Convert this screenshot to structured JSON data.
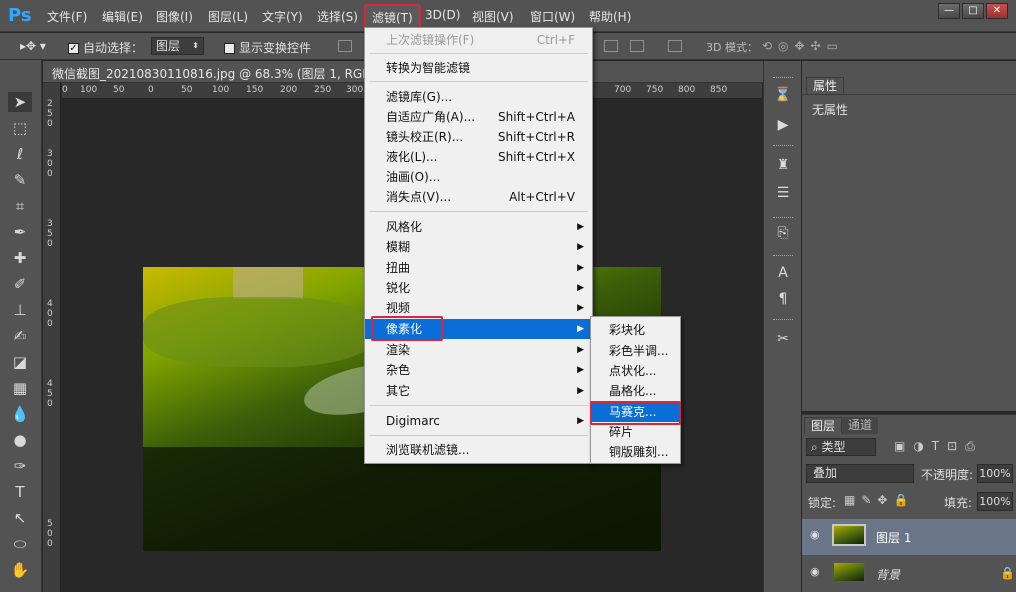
{
  "app": {
    "logo": "Ps"
  },
  "menubar": {
    "items": [
      "文件(F)",
      "编辑(E)",
      "图像(I)",
      "图层(L)",
      "文字(Y)",
      "选择(S)",
      "滤镜(T)",
      "3D(D)",
      "视图(V)",
      "窗口(W)",
      "帮助(H)"
    ],
    "active": "滤镜(T)"
  },
  "window_buttons": [
    "—",
    "□",
    "✕"
  ],
  "options": {
    "auto_select_label": "自动选择：",
    "auto_select_target": "图层",
    "show_transform_label": "显示变换控件",
    "mode_3d_label": "3D 模式："
  },
  "document": {
    "tab_title": "微信截图_20210830110816.jpg @ 68.3% (图层 1, RGB/8#) *"
  },
  "ruler_h": {
    "ticks": [
      "0",
      "100",
      "50",
      "0",
      "50",
      "100",
      "150",
      "200",
      "250",
      "300",
      "700",
      "750",
      "800",
      "850"
    ]
  },
  "ruler_v": {
    "ticks": [
      "2 5 0",
      "3 0 0",
      "3 5 0",
      "4 0 0",
      "4 5 0",
      "5 0 0"
    ]
  },
  "filter_menu": {
    "items": [
      {
        "label": "上次滤镜操作(F)",
        "shortcut": "Ctrl+F",
        "disabled": true
      },
      {
        "label": "转换为智能滤镜"
      },
      {
        "label": "滤镜库(G)..."
      },
      {
        "label": "自适应广角(A)...",
        "shortcut": "Shift+Ctrl+A"
      },
      {
        "label": "镜头校正(R)...",
        "shortcut": "Shift+Ctrl+R"
      },
      {
        "label": "液化(L)...",
        "shortcut": "Shift+Ctrl+X"
      },
      {
        "label": "油画(O)..."
      },
      {
        "label": "消失点(V)...",
        "shortcut": "Alt+Ctrl+V"
      },
      {
        "label": "风格化",
        "submenu": true
      },
      {
        "label": "模糊",
        "submenu": true
      },
      {
        "label": "扭曲",
        "submenu": true
      },
      {
        "label": "锐化",
        "submenu": true
      },
      {
        "label": "视频",
        "submenu": true
      },
      {
        "label": "像素化",
        "submenu": true,
        "highlighted": true
      },
      {
        "label": "渲染",
        "submenu": true
      },
      {
        "label": "杂色",
        "submenu": true
      },
      {
        "label": "其它",
        "submenu": true
      },
      {
        "label": "Digimarc",
        "submenu": true
      },
      {
        "label": "浏览联机滤镜..."
      }
    ],
    "arrow": "▶"
  },
  "pixelate_submenu": {
    "items": [
      "彩块化",
      "彩色半调...",
      "点状化...",
      "晶格化...",
      "马赛克...",
      "碎片",
      "铜版雕刻..."
    ],
    "highlighted": "马赛克..."
  },
  "properties_panel": {
    "tab": "属性",
    "content": "无属性"
  },
  "layers_panel": {
    "tabs": [
      "图层",
      "通道"
    ],
    "filter_kind": "类型",
    "blend_mode": "叠加",
    "opacity_label": "不透明度:",
    "opacity_value": "100%",
    "lock_label": "锁定:",
    "fill_label": "填充:",
    "fill_value": "100%",
    "layers": [
      {
        "name": "图层 1",
        "selected": true
      },
      {
        "name": "背景",
        "locked": true
      }
    ]
  },
  "colors": {
    "highlight": "#0a6ed6",
    "annotation_red": "#d9263a",
    "ps_blue": "#31a8ff"
  }
}
